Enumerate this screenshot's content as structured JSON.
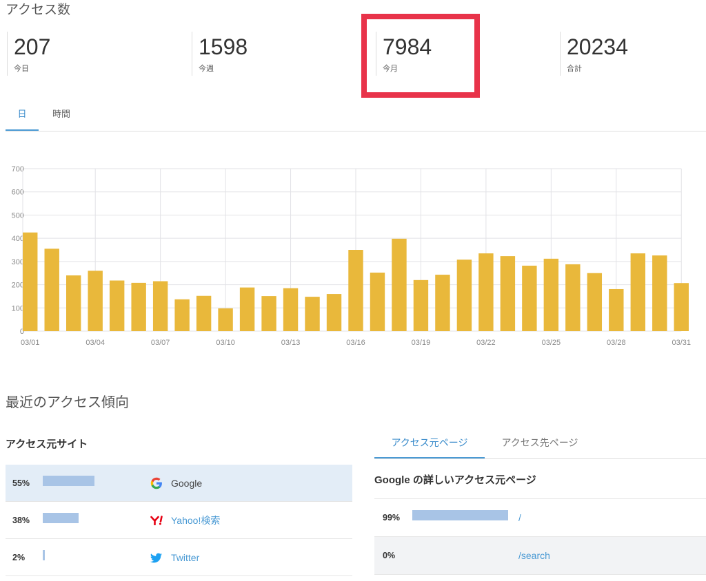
{
  "header": {
    "title": "アクセス数"
  },
  "stats": [
    {
      "value": "207",
      "label": "今日",
      "highlighted": false
    },
    {
      "value": "1598",
      "label": "今週",
      "highlighted": false
    },
    {
      "value": "7984",
      "label": "今月",
      "highlighted": true
    },
    {
      "value": "20234",
      "label": "合計",
      "highlighted": false
    }
  ],
  "chart_tabs": [
    {
      "label": "日",
      "active": true
    },
    {
      "label": "時間",
      "active": false
    }
  ],
  "chart_data": {
    "type": "bar",
    "categories": [
      "03/01",
      "03/02",
      "03/03",
      "03/04",
      "03/05",
      "03/06",
      "03/07",
      "03/08",
      "03/09",
      "03/10",
      "03/11",
      "03/12",
      "03/13",
      "03/14",
      "03/15",
      "03/16",
      "03/17",
      "03/18",
      "03/19",
      "03/20",
      "03/21",
      "03/22",
      "03/23",
      "03/24",
      "03/25",
      "03/26",
      "03/27",
      "03/28",
      "03/29",
      "03/30",
      "03/31"
    ],
    "values": [
      425,
      355,
      240,
      260,
      218,
      208,
      215,
      137,
      152,
      98,
      188,
      151,
      185,
      148,
      160,
      350,
      252,
      398,
      220,
      243,
      308,
      335,
      323,
      282,
      312,
      288,
      250,
      181,
      335,
      326,
      207
    ],
    "yticks": [
      0,
      100,
      200,
      300,
      400,
      500,
      600,
      700
    ],
    "ylim": [
      0,
      700
    ],
    "grid": true,
    "color": "#e9b83b"
  },
  "trends": {
    "title": "最近のアクセス傾向",
    "sources": {
      "title": "アクセス元サイト",
      "rows": [
        {
          "percent": "55%",
          "icon": "google-icon",
          "name": "Google",
          "selected": true
        },
        {
          "percent": "38%",
          "icon": "yahoo-icon",
          "name": "Yahoo!検索",
          "selected": false
        },
        {
          "percent": "2%",
          "icon": "twitter-icon",
          "name": "Twitter",
          "selected": false
        }
      ]
    },
    "pages": {
      "tabs": [
        {
          "label": "アクセス元ページ",
          "active": true
        },
        {
          "label": "アクセス先ページ",
          "active": false
        }
      ],
      "title": "Google の詳しいアクセス元ページ",
      "rows": [
        {
          "percent": "99%",
          "path": "/"
        },
        {
          "percent": "0%",
          "path": "/search"
        }
      ]
    }
  },
  "colors": {
    "accent": "#4a9ad4",
    "annotation_highlight": "#e8334a",
    "selected_row": "#e3edf7",
    "share_bar": "#a8c4e6"
  }
}
